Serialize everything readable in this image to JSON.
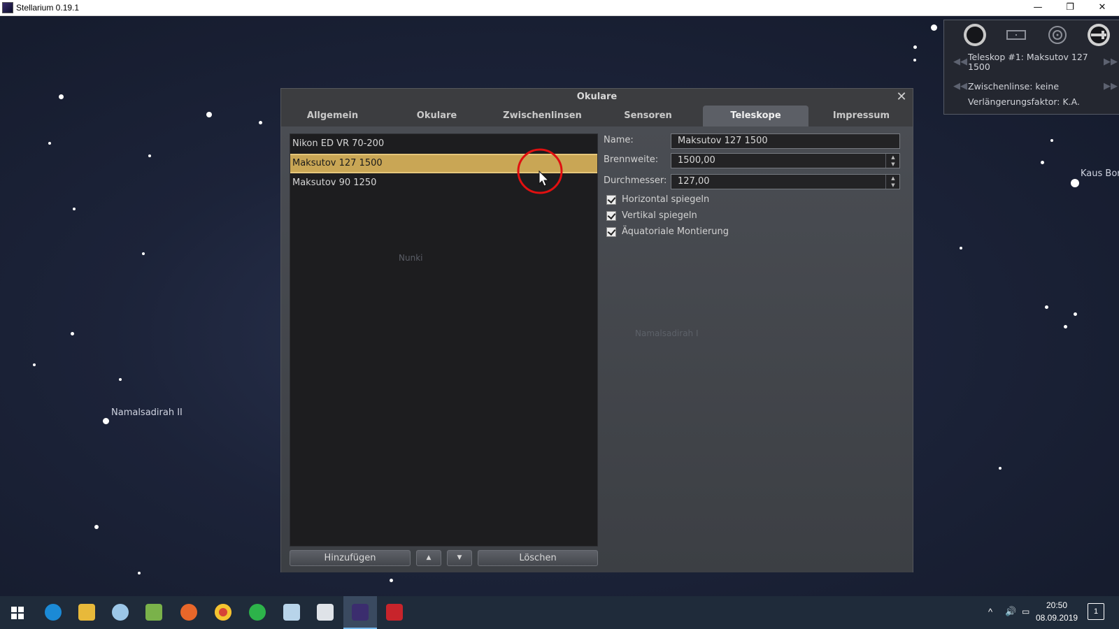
{
  "window": {
    "title": "Stellarium 0.19.1",
    "minimize": "—",
    "restore": "❐",
    "close": "✕"
  },
  "sky_labels": [
    "Namalsadirah II",
    "Kaus Bor",
    "Nunki",
    "Namalsadirah I"
  ],
  "ocular_panel": {
    "telescope_line": "Teleskop #1: Maksutov 127 1500",
    "lens_line": "Zwischenlinse: keine",
    "factor_line": "Verlängerungsfaktor: K.A."
  },
  "dialog": {
    "title": "Okulare",
    "close": "✕",
    "tabs": [
      "Allgemein",
      "Okulare",
      "Zwischenlinsen",
      "Sensoren",
      "Teleskope",
      "Impressum"
    ],
    "active_tab": "Teleskope",
    "telescopes": [
      "Nikon ED VR 70-200",
      "Maksutov 127 1500",
      "Maksutov 90 1250"
    ],
    "selected_index": 1,
    "buttons": {
      "add": "Hinzufügen",
      "up": "▲",
      "down": "▼",
      "delete": "Löschen"
    },
    "form": {
      "name_label": "Name:",
      "name_value": "Maksutov 127 1500",
      "focal_label": "Brennweite:",
      "focal_value": "1500,00",
      "diameter_label": "Durchmesser:",
      "diameter_value": "127,00",
      "checkboxes": [
        "Horizontal spiegeln",
        "Vertikal spiegeln",
        "Äquatoriale Montierung"
      ]
    }
  },
  "taskbar": {
    "time": "20:50",
    "date": "08.09.2019",
    "notifications": "1"
  },
  "colors": {
    "selection": "#c9a655",
    "dialog_bg": "#3c3d40",
    "taskbar_bg": "#1f2b3a"
  }
}
